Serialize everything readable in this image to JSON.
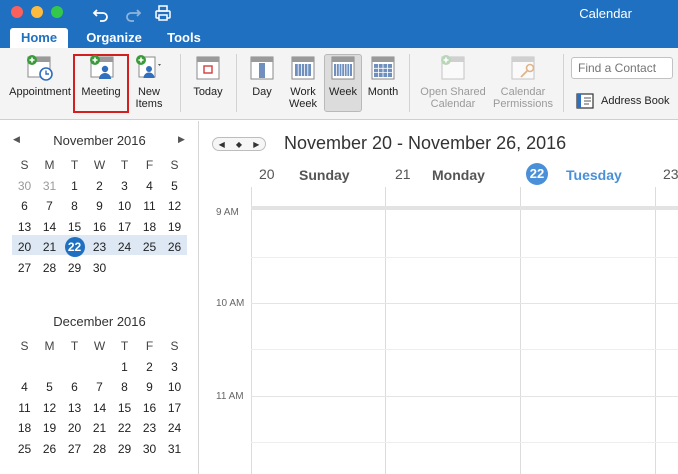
{
  "window": {
    "title": "Calendar"
  },
  "tabs": [
    {
      "label": "Home",
      "active": true
    },
    {
      "label": "Organize",
      "active": false
    },
    {
      "label": "Tools",
      "active": false
    }
  ],
  "ribbon": {
    "appointment": "Appointment",
    "meeting": "Meeting",
    "new_items_line1": "New",
    "new_items_line2": "Items",
    "today": "Today",
    "day": "Day",
    "work_week_line1": "Work",
    "work_week_line2": "Week",
    "week": "Week",
    "month": "Month",
    "open_shared_line1": "Open Shared",
    "open_shared_line2": "Calendar",
    "cal_perm_line1": "Calendar",
    "cal_perm_line2": "Permissions",
    "find_contact_placeholder": "Find a Contact",
    "address_book": "Address Book"
  },
  "mini_calendars": [
    {
      "title": "November 2016",
      "weekdays": [
        "S",
        "M",
        "T",
        "W",
        "T",
        "F",
        "S"
      ],
      "weeks": [
        [
          "30",
          "31",
          "1",
          "2",
          "3",
          "4",
          "5"
        ],
        [
          "6",
          "7",
          "8",
          "9",
          "10",
          "11",
          "12"
        ],
        [
          "13",
          "14",
          "15",
          "16",
          "17",
          "18",
          "19"
        ],
        [
          "20",
          "21",
          "22",
          "23",
          "24",
          "25",
          "26"
        ],
        [
          "27",
          "28",
          "29",
          "30",
          "",
          "",
          ""
        ]
      ],
      "today": "22"
    },
    {
      "title": "December 2016",
      "weekdays": [
        "S",
        "M",
        "T",
        "W",
        "T",
        "F",
        "S"
      ],
      "weeks": [
        [
          "",
          "",
          "",
          "",
          "1",
          "2",
          "3"
        ],
        [
          "4",
          "5",
          "6",
          "7",
          "8",
          "9",
          "10"
        ],
        [
          "11",
          "12",
          "13",
          "14",
          "15",
          "16",
          "17"
        ],
        [
          "18",
          "19",
          "20",
          "21",
          "22",
          "23",
          "24"
        ],
        [
          "25",
          "26",
          "27",
          "28",
          "29",
          "30",
          "31"
        ]
      ]
    }
  ],
  "main": {
    "range_title": "November 20 - November 26, 2016",
    "days": [
      {
        "num": "20",
        "name": "Sunday"
      },
      {
        "num": "21",
        "name": "Monday"
      },
      {
        "num": "22",
        "name": "Tuesday",
        "today": true
      },
      {
        "num": "23",
        "name": ""
      }
    ],
    "time_labels": [
      "9 AM",
      "10 AM",
      "11 AM"
    ]
  },
  "colors": {
    "accent": "#1f70c1",
    "today_blue": "#4a90d9",
    "highlight_red": "#d21f1f"
  }
}
